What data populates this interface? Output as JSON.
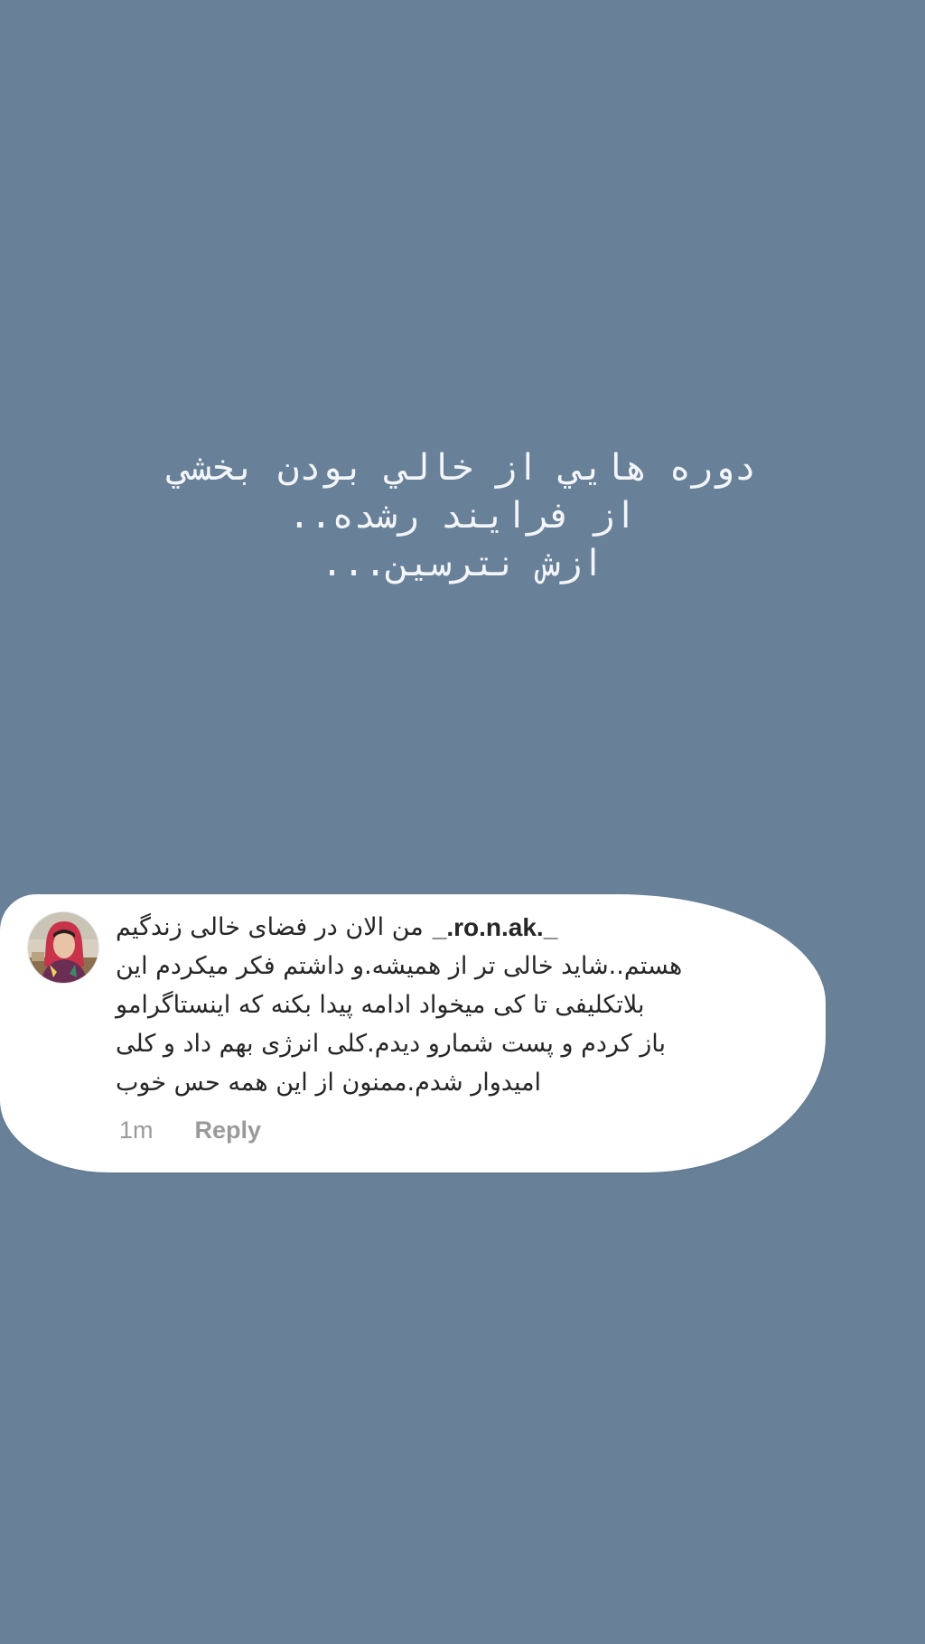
{
  "story": {
    "caption_lines": [
      "دوره هايي از خالي بودن بخشي",
      "از فرايند رشده..",
      "ازش نترسين..."
    ]
  },
  "comment": {
    "username": "_.ro.n.ak._",
    "lines": [
      "من الان در فضای خالی زندگیم",
      "هستم..شاید خالی تر از همیشه.و داشتم فکر میکردم این",
      "بلاتکلیفی تا کی میخواد ادامه پیدا بکنه که اینستاگرامو",
      "باز کردم و پست شمارو دیدم.کلی انرژی بهم داد و کلی",
      "امیدوار شدم.ممنون از این همه حس خوب"
    ],
    "time": "1m",
    "reply_label": "Reply"
  },
  "colors": {
    "background": "#688198",
    "bubble": "#ffffff",
    "text": "#262626",
    "meta": "#9a9a9a"
  }
}
